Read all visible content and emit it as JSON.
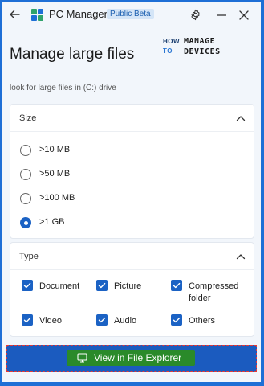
{
  "titlebar": {
    "app_name": "PC Manager",
    "badge": "Public Beta",
    "icons": [
      "back-arrow-icon",
      "app-logo-icon",
      "settings-icon",
      "minimize-icon",
      "close-icon"
    ]
  },
  "watermark": {
    "how": "HOW",
    "to": "TO",
    "manage": "MANAGE",
    "devices": "DEVICES"
  },
  "page": {
    "title": "Manage large files",
    "subtitle": "look for large files in (C:) drive"
  },
  "size_section": {
    "title": "Size",
    "options": [
      {
        "label": ">10 MB",
        "checked": false
      },
      {
        "label": ">50 MB",
        "checked": false
      },
      {
        "label": ">100 MB",
        "checked": false
      },
      {
        "label": ">1 GB",
        "checked": true
      }
    ]
  },
  "type_section": {
    "title": "Type",
    "options": [
      {
        "label": "Document",
        "checked": true
      },
      {
        "label": "Picture",
        "checked": true
      },
      {
        "label": "Compressed folder",
        "checked": true
      },
      {
        "label": "Video",
        "checked": true
      },
      {
        "label": "Audio",
        "checked": true
      },
      {
        "label": "Others",
        "checked": true
      }
    ]
  },
  "footer": {
    "button_label": "View in File Explorer"
  },
  "colors": {
    "accent": "#1b62c4",
    "footer_bg": "#1b5bbf",
    "button_highlight": "#2a8a2a",
    "dashed_outline": "#e53935"
  }
}
